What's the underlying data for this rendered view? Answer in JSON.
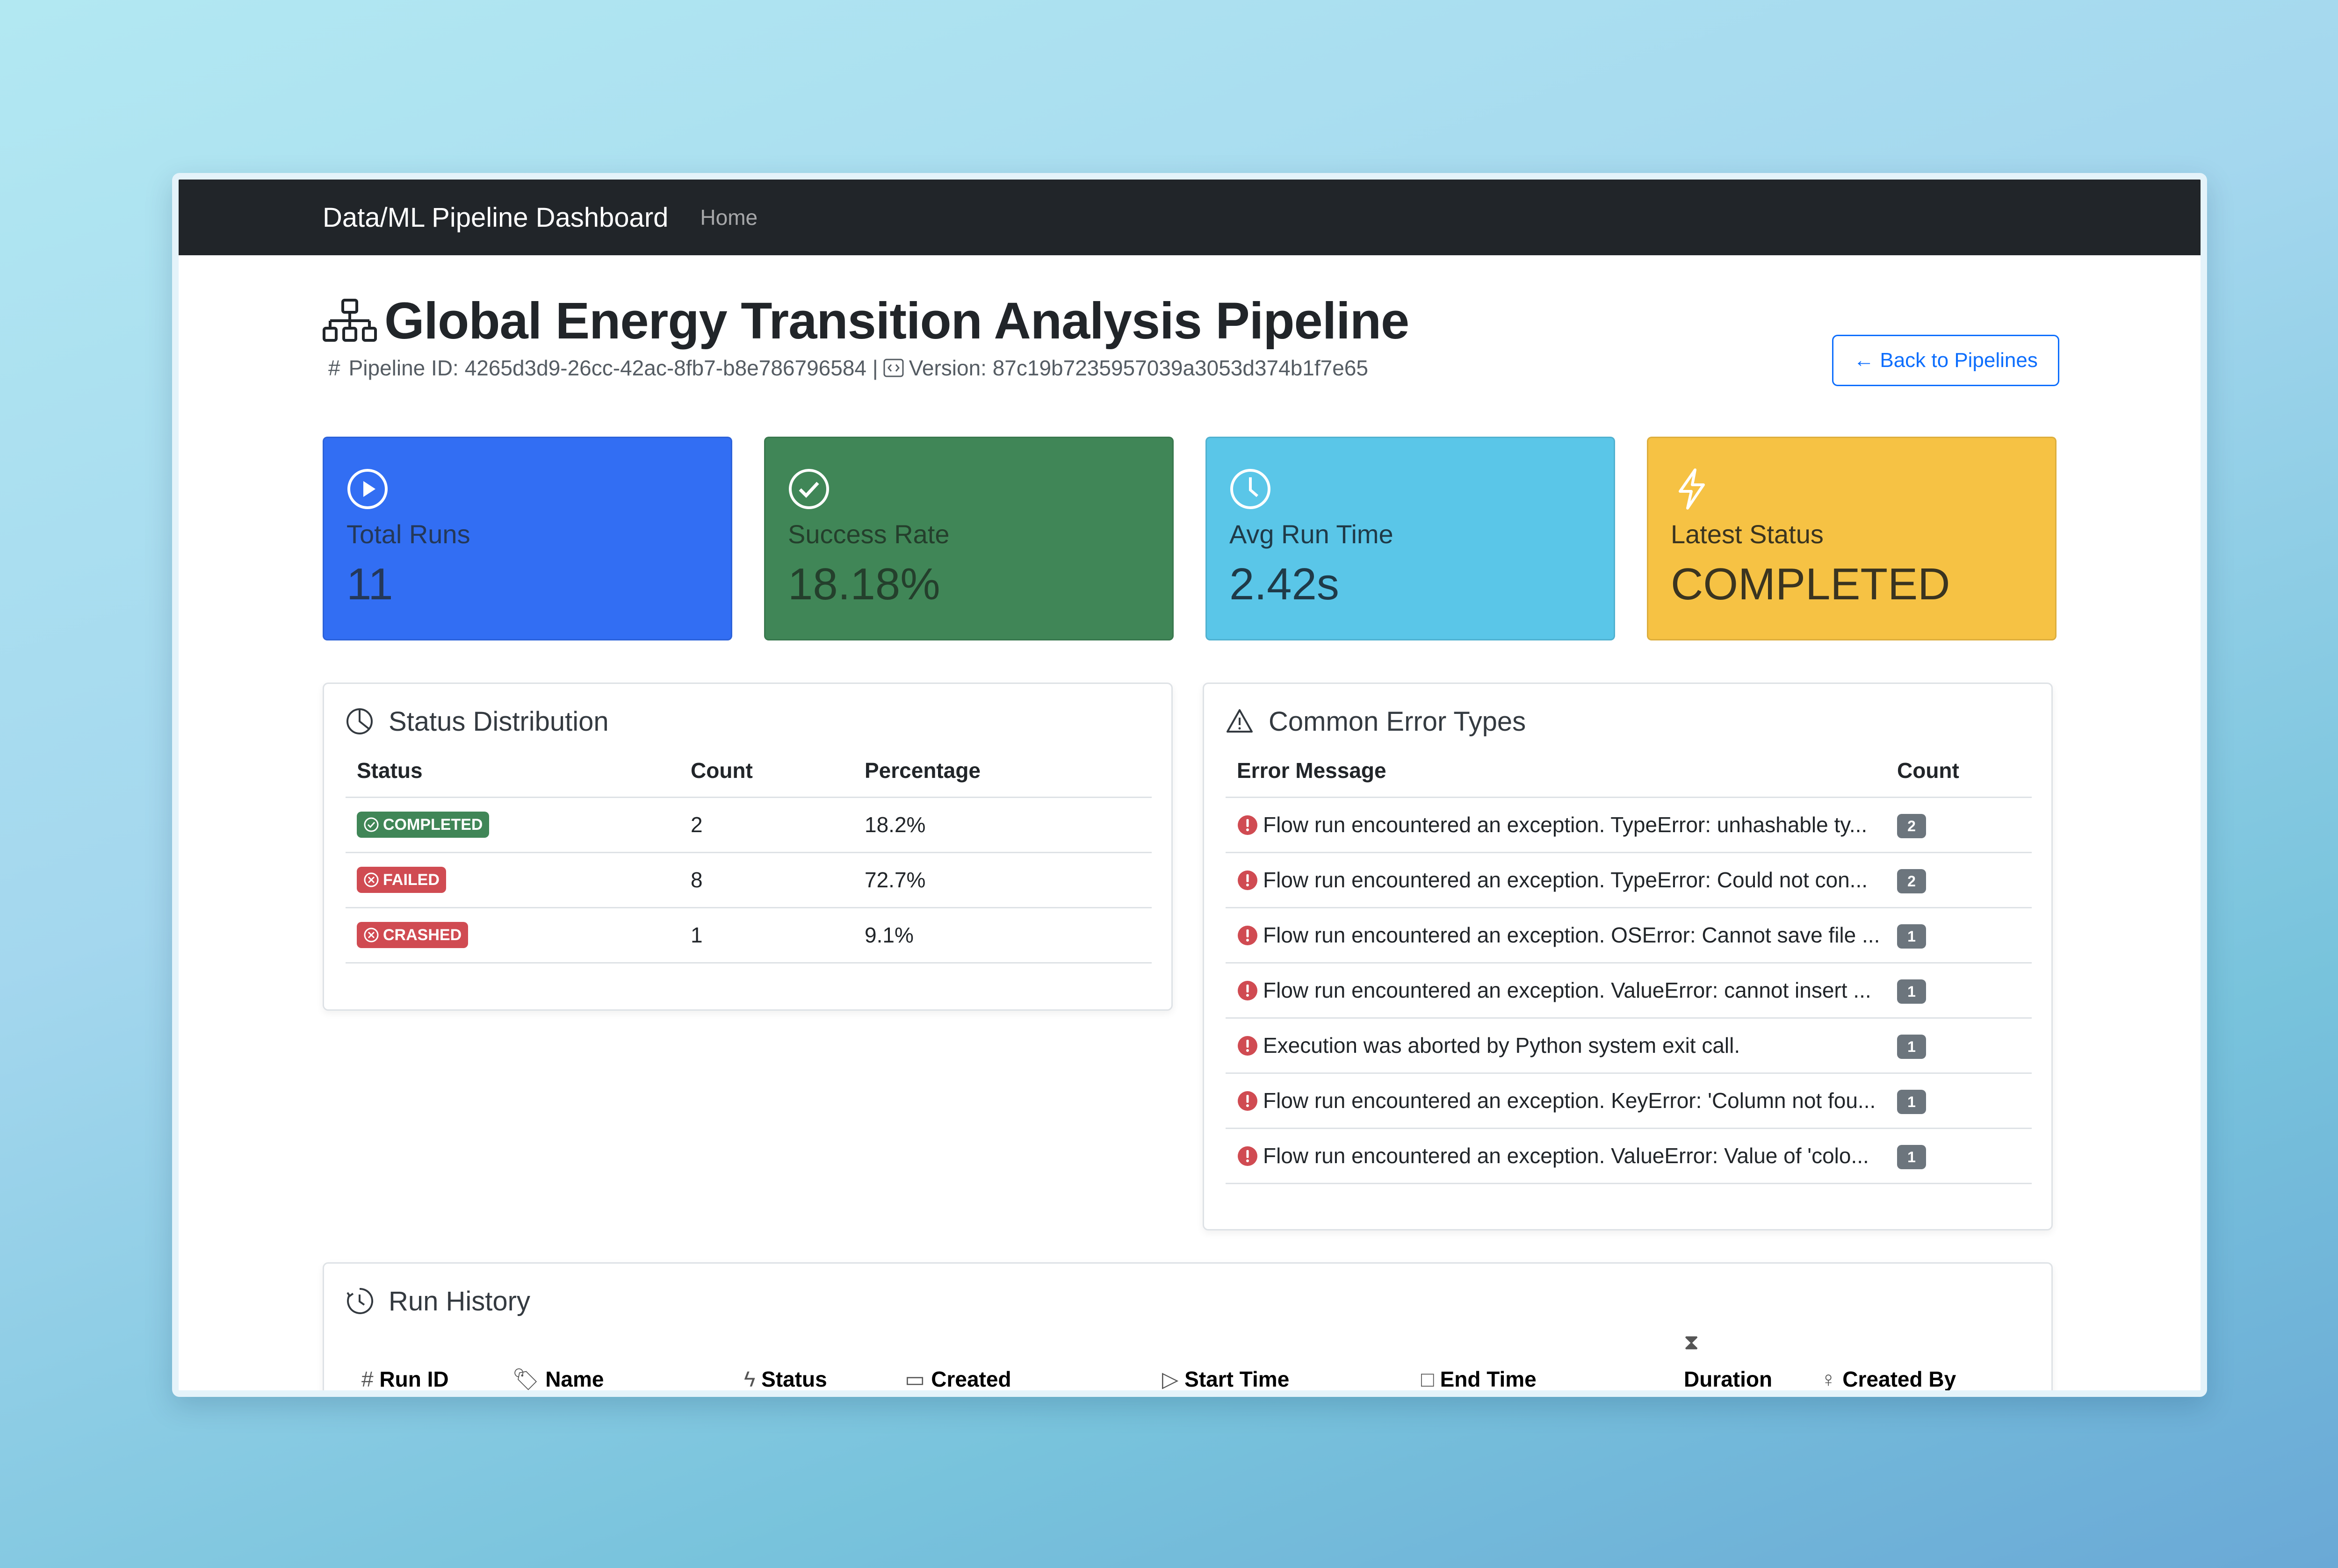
{
  "navbar": {
    "brand": "Data/ML Pipeline Dashboard",
    "home": "Home"
  },
  "header": {
    "title": "Global Energy Transition Analysis Pipeline",
    "back_button": "← Back to Pipelines",
    "pipeline_id": "Pipeline ID: 4265d3d9-26cc-42ac-8fb7-b8e786796584 |",
    "version": "Version: 87c19b7235957039a3053d374b1f7e65"
  },
  "cards": [
    {
      "label": "Total Runs",
      "value": "11",
      "icon": "play-circle-icon",
      "color": "#326ef3"
    },
    {
      "label": "Success Rate",
      "value": "18.18%",
      "icon": "check-circle-icon",
      "color": "#408657"
    },
    {
      "label": "Avg Run Time",
      "value": "2.42s",
      "icon": "clock-icon",
      "color": "#5ac6e8"
    },
    {
      "label": "Latest Status",
      "value": "COMPLETED",
      "icon": "lightning-icon",
      "color": "#f6c244"
    }
  ],
  "status_distribution": {
    "title": "Status Distribution",
    "columns": [
      "Status",
      "Count",
      "Percentage"
    ],
    "rows": [
      {
        "status": "COMPLETED",
        "count": "2",
        "percentage": "18.2%",
        "color": "#408657"
      },
      {
        "status": "FAILED",
        "count": "8",
        "percentage": "72.7%",
        "color": "#d04b52"
      },
      {
        "status": "CRASHED",
        "count": "1",
        "percentage": "9.1%",
        "color": "#d04b52"
      }
    ]
  },
  "errors": {
    "title": "Common Error Types",
    "columns": [
      "Error Message",
      "Count"
    ],
    "rows": [
      {
        "message": "Flow run encountered an exception. TypeError: unhashable ty...",
        "count": "2"
      },
      {
        "message": "Flow run encountered an exception. TypeError: Could not con...",
        "count": "2"
      },
      {
        "message": "Flow run encountered an exception. OSError: Cannot save file ...",
        "count": "1"
      },
      {
        "message": "Flow run encountered an exception. ValueError: cannot insert ...",
        "count": "1"
      },
      {
        "message": "Execution was aborted by Python system exit call.",
        "count": "1"
      },
      {
        "message": "Flow run encountered an exception. KeyError: 'Column not fou...",
        "count": "1"
      },
      {
        "message": "Flow run encountered an exception. ValueError: Value of 'colo...",
        "count": "1"
      }
    ]
  },
  "run_history": {
    "title": "Run History",
    "columns": {
      "run_id": "Run ID",
      "name": "Name",
      "status": "Status",
      "created": "Created",
      "start": "Start Time",
      "end": "End Time",
      "duration": "Duration",
      "created_by": "Created By"
    }
  }
}
